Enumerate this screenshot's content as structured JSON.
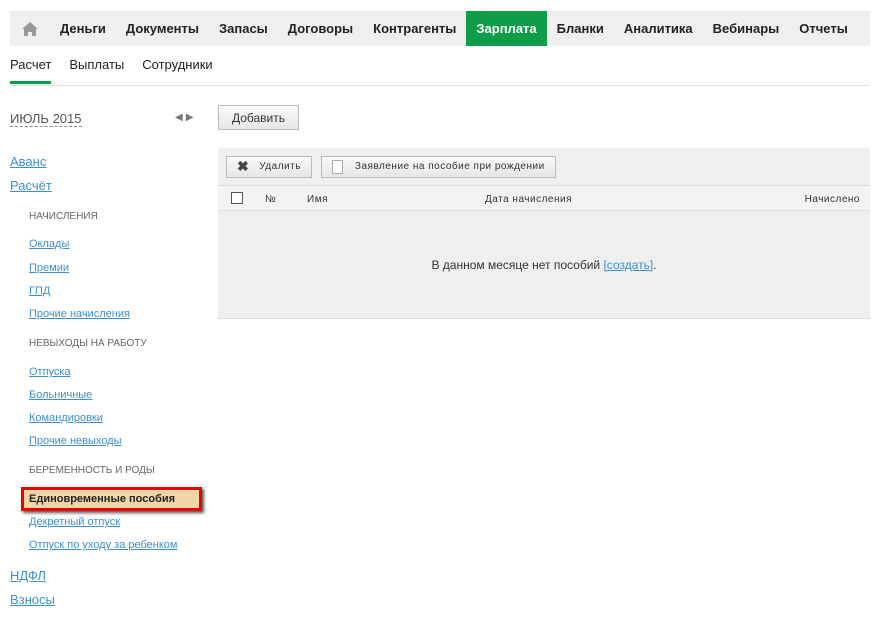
{
  "topnav": {
    "items": [
      "Деньги",
      "Документы",
      "Запасы",
      "Договоры",
      "Контрагенты",
      "Зарплата",
      "Бланки",
      "Аналитика",
      "Вебинары",
      "Отчеты"
    ],
    "active": "Зарплата"
  },
  "subnav": {
    "items": [
      "Расчет",
      "Выплаты",
      "Сотрудники"
    ]
  },
  "period": {
    "month": "ИЮЛЬ 2015",
    "arrows": "◀▶"
  },
  "add_button": "Добавить",
  "sidebar": {
    "avans": "Аванс",
    "raschet": "Расчёт",
    "cat1": "НАЧИСЛЕНИЯ",
    "oklady": "Оклады",
    "premii": "Премии",
    "gpd": "ГПД",
    "prochie_nach": "Прочие начисления",
    "cat2": "НЕВЫХОДЫ НА РАБОТУ",
    "otpuska": "Отпуска",
    "bolnichnye": "Больничные",
    "komandirovki": "Командировки",
    "prochie_nev": "Прочие невыходы",
    "cat3": "БЕРЕМЕННОСТЬ И РОДЫ",
    "edinovremennye": "Единовременные пособия",
    "dekret": "Декретный отпуск",
    "uhod": "Отпуск по уходу за ребенком",
    "ndfl": "НДФЛ",
    "vznosy": "Взносы"
  },
  "toolbar": {
    "delete": "Удалить",
    "statement": "Заявление на пособие при рождении"
  },
  "table": {
    "headers": {
      "num": "№",
      "name": "Имя",
      "date": "Дата начисления",
      "amount": "Начислено"
    },
    "empty_text": "В данном месяце нет пособий ",
    "empty_link": "[создать]",
    "empty_end": "."
  },
  "colors": {
    "accent": "#0f9d49",
    "link": "#3d8fd1",
    "highlight": "#f0d6a6"
  }
}
